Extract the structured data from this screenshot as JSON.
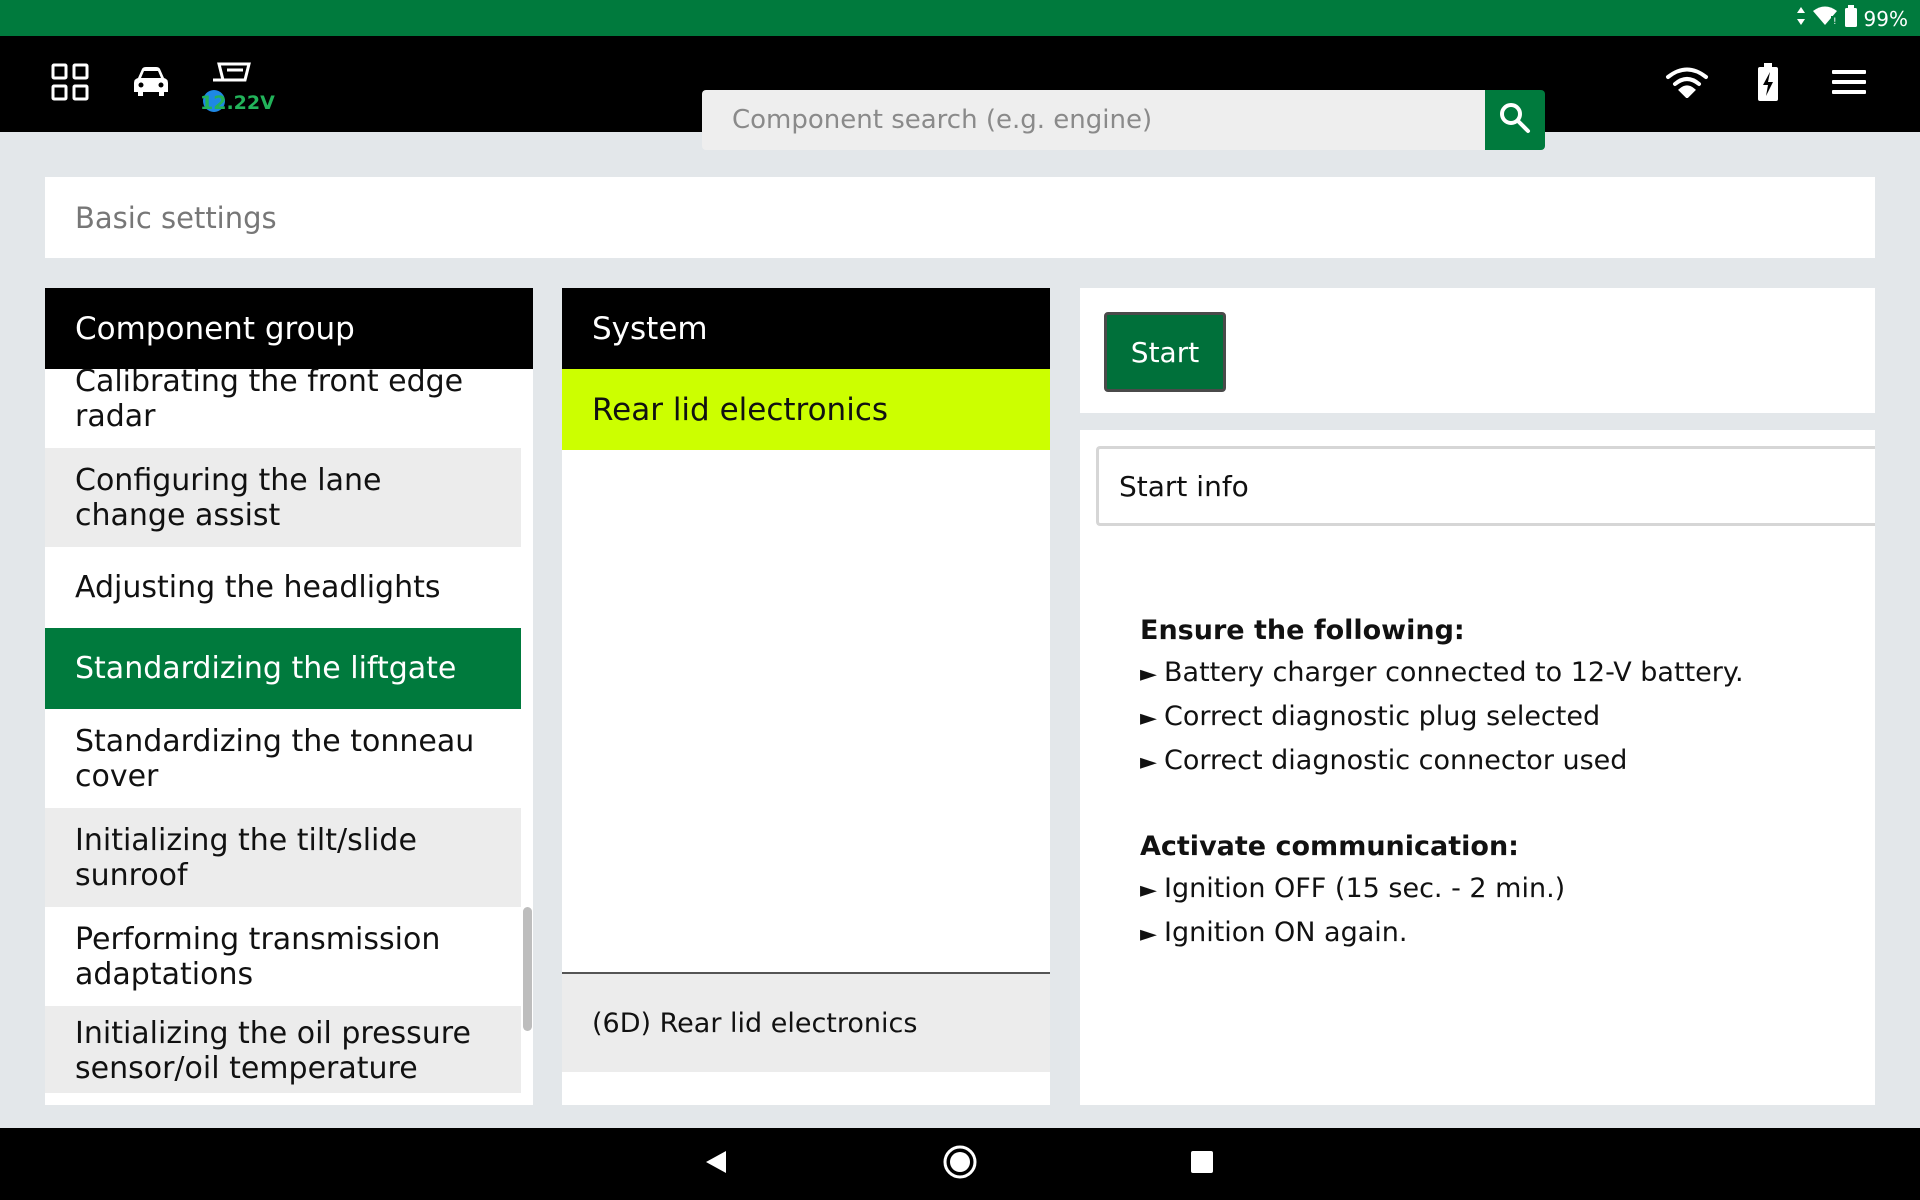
{
  "status_bar": {
    "battery_text": "99%",
    "icons": [
      "data-arrows-icon",
      "wifi-icon",
      "battery-icon"
    ]
  },
  "top_bar": {
    "voltage": "12.22V",
    "icons": [
      "apps-grid-icon",
      "car-icon",
      "obd-connector-icon",
      "wifi-icon",
      "battery-charging-icon",
      "menu-icon"
    ],
    "search": {
      "placeholder": "Component search (e.g. engine)",
      "value": ""
    }
  },
  "page": {
    "title": "Basic settings"
  },
  "component_group": {
    "header": "Component group",
    "items": [
      {
        "label": "Calibrating the front edge radar"
      },
      {
        "label": "Configuring the lane change assist"
      },
      {
        "label": "Adjusting the headlights"
      },
      {
        "label": "Standardizing the liftgate",
        "selected": true
      },
      {
        "label": "Standardizing the tonneau cover"
      },
      {
        "label": "Initializing the tilt/slide sunroof"
      },
      {
        "label": "Performing transmission adaptations"
      },
      {
        "label": "Initializing the oil pressure sensor/oil temperature sensor"
      }
    ]
  },
  "system": {
    "header": "System",
    "items": [
      {
        "label": "Rear lid electronics",
        "selected": true
      }
    ],
    "footer": "(6D) Rear lid electronics"
  },
  "action": {
    "start_label": "Start",
    "tab_label": "Start info",
    "info": {
      "section1_title": "Ensure the following:",
      "section1_items": [
        "Battery charger connected to 12-V battery.",
        "Correct diagnostic plug selected",
        "Correct diagnostic connector used"
      ],
      "section2_title": "Activate communication:",
      "section2_items": [
        "Ignition OFF (15 sec. - 2 min.)",
        "Ignition ON again."
      ],
      "bullet": "►"
    }
  },
  "colors": {
    "status_bar": "#007a3d",
    "accent_green": "#007a3d",
    "system_highlight": "#ccff00",
    "voltage_text": "#22b35a"
  },
  "nav_bar": {
    "icons": [
      "back-icon",
      "home-icon",
      "recents-icon"
    ]
  }
}
